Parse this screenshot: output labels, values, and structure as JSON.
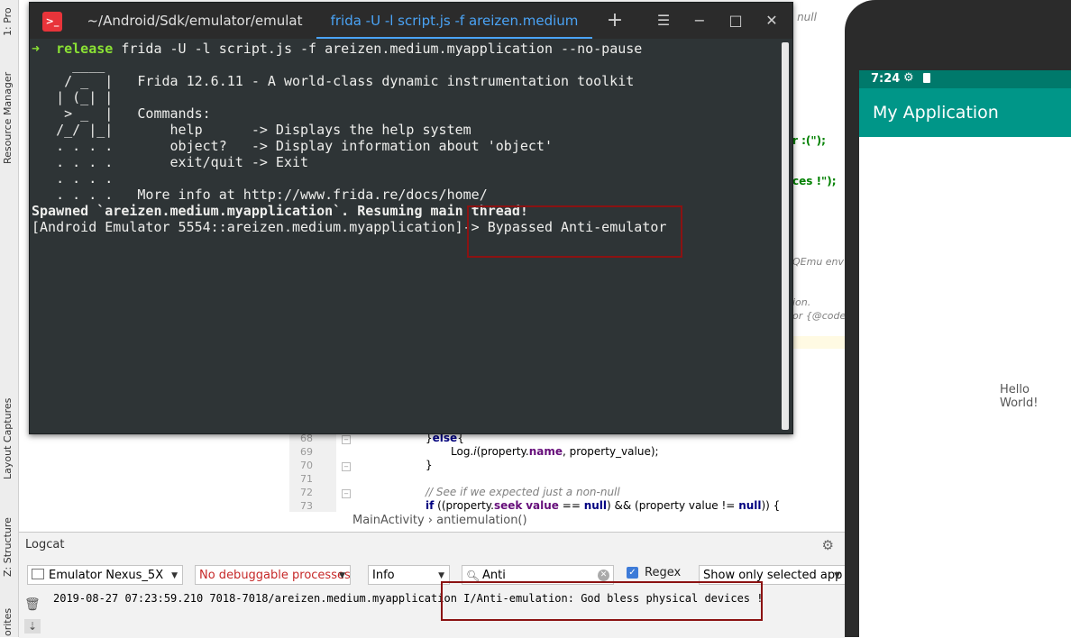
{
  "left_strip": {
    "tab_project": "1: Pro",
    "tab_resource_manager": "Resource Manager",
    "tab_layout_captures": "Layout Captures",
    "tab_structure": "Z: Structure",
    "tab_favorites": "orites"
  },
  "editor": {
    "fragments": {
      "frag_null": "s null",
      "frag_r": "r :(\");",
      "frag_ces": "ces !\");",
      "frag_qemu": "QEmu env",
      "frag_ion": "ion.",
      "frag_code": "or {@code"
    },
    "line_numbers": [
      "68",
      "69",
      "70",
      "71",
      "72",
      "73"
    ],
    "breadcrumb": [
      "MainActivity",
      "›",
      "antiemulation()"
    ]
  },
  "logcat": {
    "title": "Logcat",
    "device": "Emulator Nexus_5X",
    "process": "No debuggable processes",
    "level": "Info",
    "search": "Anti",
    "regex_label": "Regex",
    "regex_checked": true,
    "filter": "Show only selected app",
    "log_line": "2019-08-27 07:23:59.210 7018-7018/areizen.medium.myapplication I/Anti-emulation: God bless physical devices !"
  },
  "terminal": {
    "tab1": "~/Android/Sdk/emulator/emulat",
    "tab2": "frida -U -l script.js -f areizen.medium",
    "prompt_arrow": "➜",
    "prompt_dir": "release",
    "command": "frida -U -l script.js -f areizen.medium.myapplication --no-pause",
    "banner": [
      "     ____",
      "    / _  |   Frida 12.6.11 - A world-class dynamic instrumentation toolkit",
      "   | (_| |",
      "    > _  |   Commands:",
      "   /_/ |_|       help      -> Displays the help system",
      "   . . . .       object?   -> Display information about 'object'",
      "   . . . .       exit/quit -> Exit",
      "   . . . .",
      "   . . . .   More info at http://www.frida.re/docs/home/"
    ],
    "spawned": "Spawned `areizen.medium.myapplication`. Resuming main thread!",
    "repl_prompt": "[Android Emulator 5554::areizen.medium.myapplication]-> ",
    "repl_output": "Bypassed Anti-emulator"
  },
  "phone": {
    "time": "7:24",
    "app_title": "My Application",
    "hello": "Hello World!"
  }
}
